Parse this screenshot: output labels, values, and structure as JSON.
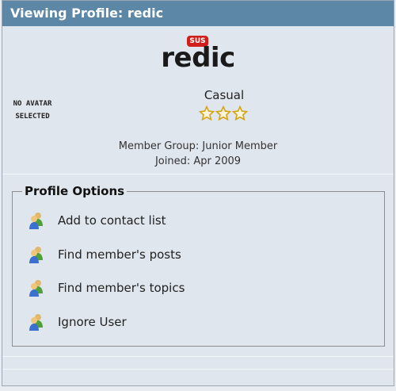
{
  "window": {
    "title": "Viewing Profile: redic"
  },
  "profile": {
    "badge": "SUS",
    "username": "redic",
    "avatar_placeholder": [
      "NO AVATAR",
      "SELECTED"
    ],
    "rank": "Casual",
    "stars": 3,
    "member_group": "Member Group: Junior Member",
    "joined": "Joined: Apr 2009"
  },
  "options": {
    "legend": "Profile Options",
    "items": [
      {
        "label": "Add to contact list",
        "icon": "users-icon"
      },
      {
        "label": "Find member's posts",
        "icon": "users-icon"
      },
      {
        "label": "Find member's topics",
        "icon": "users-icon"
      },
      {
        "label": "Ignore User",
        "icon": "users-icon"
      }
    ]
  },
  "colors": {
    "titlebar": "#5c87a6",
    "badge": "#d21d1d",
    "star": "#f2c21b"
  }
}
